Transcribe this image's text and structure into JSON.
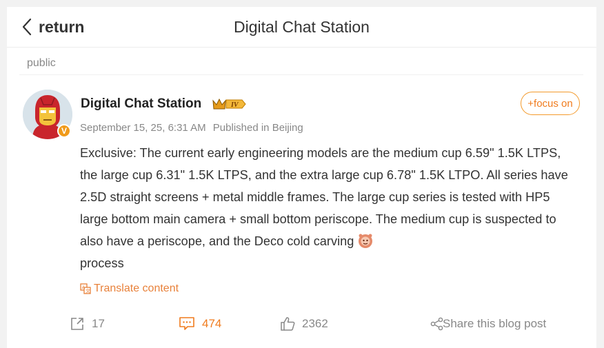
{
  "header": {
    "back_label": "return",
    "title": "Digital Chat Station"
  },
  "visibility": "public",
  "post": {
    "author": "Digital Chat Station",
    "level_badge": "IV",
    "verified_badge": "V",
    "date": "September 15, 25, 6:31 AM",
    "location": "Published in Beijing",
    "follow_label": "+focus on",
    "content": "Exclusive: The current early engineering models are the medium cup 6.59\" 1.5K LTPS, the large cup 6.31\" 1.5K LTPS, and the extra large cup 6.78\" 1.5K LTPO. All series have 2.5D straight screens + metal middle frames. The large cup series is tested with HP5 large bottom main camera + small bottom periscope. The medium cup is suspected to also have a periscope, and the Deco cold carving",
    "content_tail": "process",
    "translate_label": "Translate content"
  },
  "actions": {
    "repost_count": "17",
    "comment_count": "474",
    "like_count": "2362",
    "share_label": "Share this blog post"
  },
  "colors": {
    "accent": "#f07b1d",
    "muted": "#888888",
    "text": "#333333"
  },
  "icons": [
    "chevron-left-icon",
    "crown-icon",
    "translate-icon",
    "repost-icon",
    "comment-icon",
    "like-icon",
    "share-icon",
    "emoji-icon"
  ]
}
